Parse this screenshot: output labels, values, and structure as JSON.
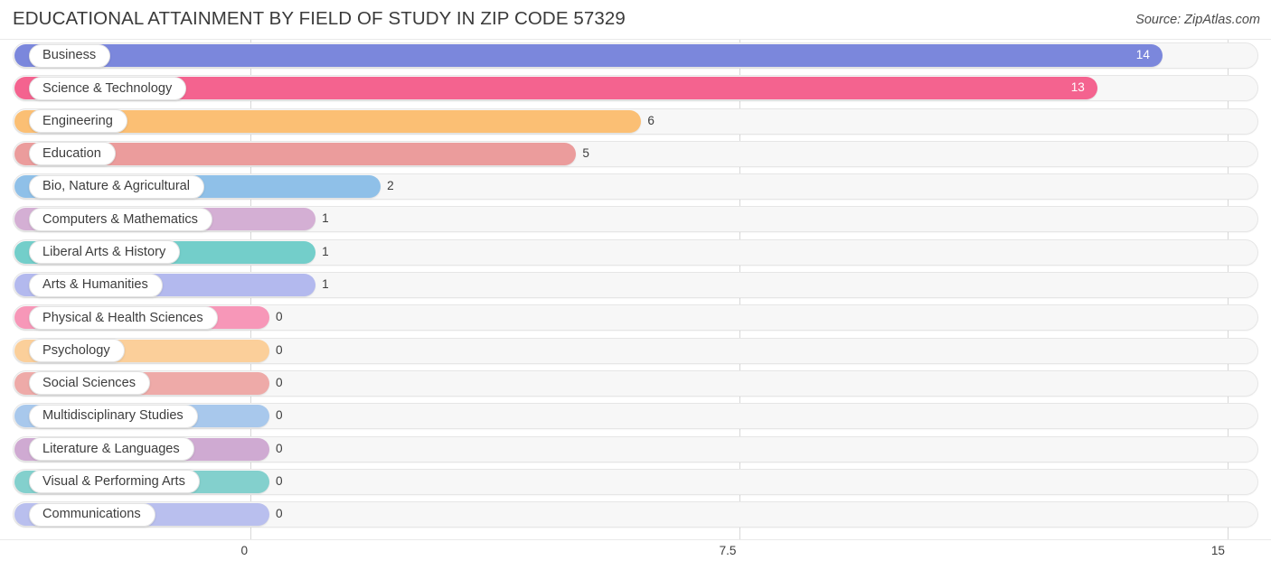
{
  "header": {
    "title": "EDUCATIONAL ATTAINMENT BY FIELD OF STUDY IN ZIP CODE 57329",
    "source": "Source: ZipAtlas.com"
  },
  "axis": {
    "ticks": [
      "0",
      "7.5",
      "15"
    ]
  },
  "chart_data": {
    "type": "bar",
    "orientation": "horizontal",
    "title": "EDUCATIONAL ATTAINMENT BY FIELD OF STUDY IN ZIP CODE 57329",
    "subtitle": "Source: ZipAtlas.com",
    "xlabel": "",
    "ylabel": "",
    "xlim": [
      0,
      15
    ],
    "xticks": [
      0,
      7.5,
      15
    ],
    "grid": true,
    "legend": "none",
    "categories": [
      "Business",
      "Science & Technology",
      "Engineering",
      "Education",
      "Bio, Nature & Agricultural",
      "Computers & Mathematics",
      "Liberal Arts & History",
      "Arts & Humanities",
      "Physical & Health Sciences",
      "Psychology",
      "Social Sciences",
      "Multidisciplinary Studies",
      "Literature & Languages",
      "Visual & Performing Arts",
      "Communications"
    ],
    "values": [
      14,
      13,
      6,
      5,
      2,
      1,
      1,
      1,
      0,
      0,
      0,
      0,
      0,
      0,
      0
    ],
    "value_labels": [
      "14",
      "13",
      "6",
      "5",
      "2",
      "1",
      "1",
      "1",
      "0",
      "0",
      "0",
      "0",
      "0",
      "0",
      "0"
    ],
    "colors": [
      "#7b87dc",
      "#f4638f",
      "#fbbf74",
      "#eb9c9c",
      "#8fc0e8",
      "#d4afd4",
      "#73ceca",
      "#b3b9ee",
      "#f797b8",
      "#fbcf9a",
      "#eeaaa8",
      "#a8c8ec",
      "#cfaad2",
      "#83d0cd",
      "#b9bfee"
    ]
  }
}
